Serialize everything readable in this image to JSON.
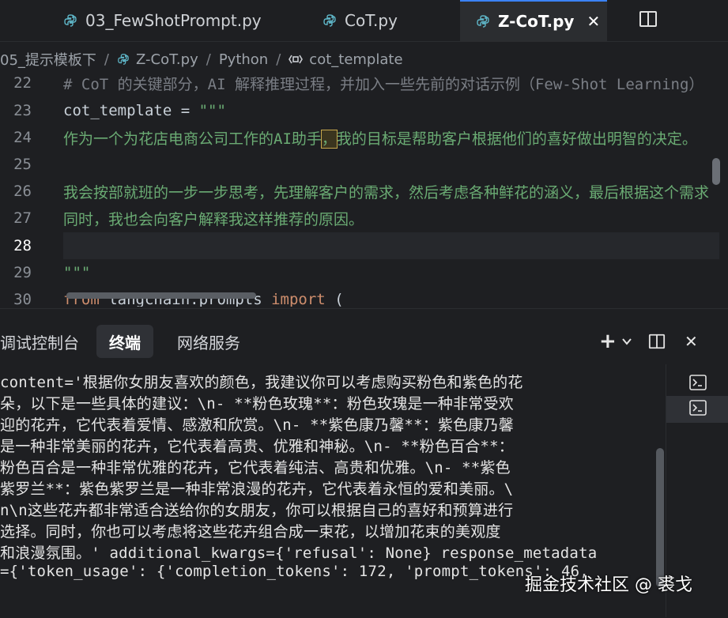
{
  "tabs": [
    {
      "label": "03_FewShotPrompt.py",
      "active": false
    },
    {
      "label": "CoT.py",
      "active": false
    },
    {
      "label": "Z-CoT.py",
      "active": true
    }
  ],
  "tab_close_glyph": "✕",
  "breadcrumb": [
    "05_提示模板下",
    "Z-CoT.py",
    "Python",
    "cot_template"
  ],
  "editor": {
    "lines": [
      {
        "num": "22",
        "text": "# CoT 的关键部分，AI 解释推理过程，并加入一些先前的对话示例（Few-Shot Learning）"
      },
      {
        "num": "23",
        "text_var": "cot_template",
        "text_op": " = ",
        "text_str": "\"\"\""
      },
      {
        "num": "24",
        "text_a": "作为一个为花店电商公司工作的AI助手",
        "text_hl": "，",
        "text_b": "我的目标是帮助客户根据他们的喜好做出明智的决定。"
      },
      {
        "num": "25",
        "text": ""
      },
      {
        "num": "26",
        "text": "我会按部就班的一步一步思考，先理解客户的需求，然后考虑各种鲜花的涵义，最后根据这个需求"
      },
      {
        "num": "27",
        "text": "同时，我也会向客户解释我这样推荐的原因。"
      },
      {
        "num": "28",
        "text": ""
      },
      {
        "num": "29",
        "text": "\"\"\""
      },
      {
        "num": "30",
        "text_kw1": "from",
        "text_mod": " langchain.prompts ",
        "text_kw2": "import",
        "text_rest": " ("
      }
    ],
    "current_line": "28"
  },
  "panel": {
    "tabs": [
      "调试控制台",
      "终端",
      "网络服务"
    ],
    "active_tab": "终端",
    "actions": {
      "add": "+",
      "dropdown": "⌄",
      "close": "✕"
    },
    "terminal_lines": [
      "content='根据你女朋友喜欢的颜色，我建议你可以考虑购买粉色和紫色的花",
      "朵，以下是一些具体的建议：\\n- **粉色玫瑰**：粉色玫瑰是一种非常受欢",
      "迎的花卉，它代表着爱情、感激和欣赏。\\n- **紫色康乃馨**：紫色康乃馨",
      "是一种非常美丽的花卉，它代表着高贵、优雅和神秘。\\n- **粉色百合**：",
      "粉色百合是一种非常优雅的花卉，它代表着纯洁、高贵和优雅。\\n- **紫色",
      "紫罗兰**：紫色紫罗兰是一种非常浪漫的花卉，它代表着永恒的爱和美丽。\\",
      "n\\n这些花卉都非常适合送给你的女朋友，你可以根据自己的喜好和预算进行",
      "选择。同时，你也可以考虑将这些花卉组合成一束花，以增加花束的美观度",
      "和浪漫氛围。' additional_kwargs={'refusal': None} response_metadata",
      "={'token_usage': {'completion_tokens': 172, 'prompt_tokens': 46,"
    ]
  },
  "watermark": "掘金技术社区 @ 裘戈",
  "colors": {
    "accent": "#3b82f6",
    "string": "#6aab73",
    "keyword": "#cf8e6d",
    "background": "#1e1f22"
  }
}
